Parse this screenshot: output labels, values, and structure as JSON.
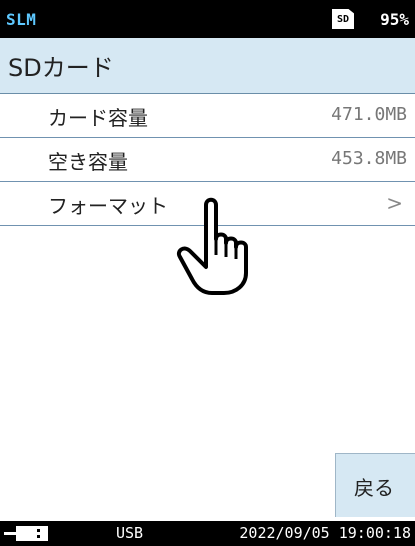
{
  "status": {
    "app": "SLM",
    "sd_badge": "SD",
    "battery": "95%"
  },
  "header": {
    "title": "SDカード"
  },
  "list": [
    {
      "label": "カード容量",
      "value": "471.0MB"
    },
    {
      "label": "空き容量",
      "value": "453.8MB"
    },
    {
      "label": "フォーマット",
      "value": ">"
    }
  ],
  "back_label": "戻る",
  "footer": {
    "usb": "USB",
    "datetime": "2022/09/05 19:00:18"
  },
  "colors": {
    "accent": "#d6e8f3",
    "status_text": "#5ec8ff",
    "divider": "#7092b0"
  }
}
